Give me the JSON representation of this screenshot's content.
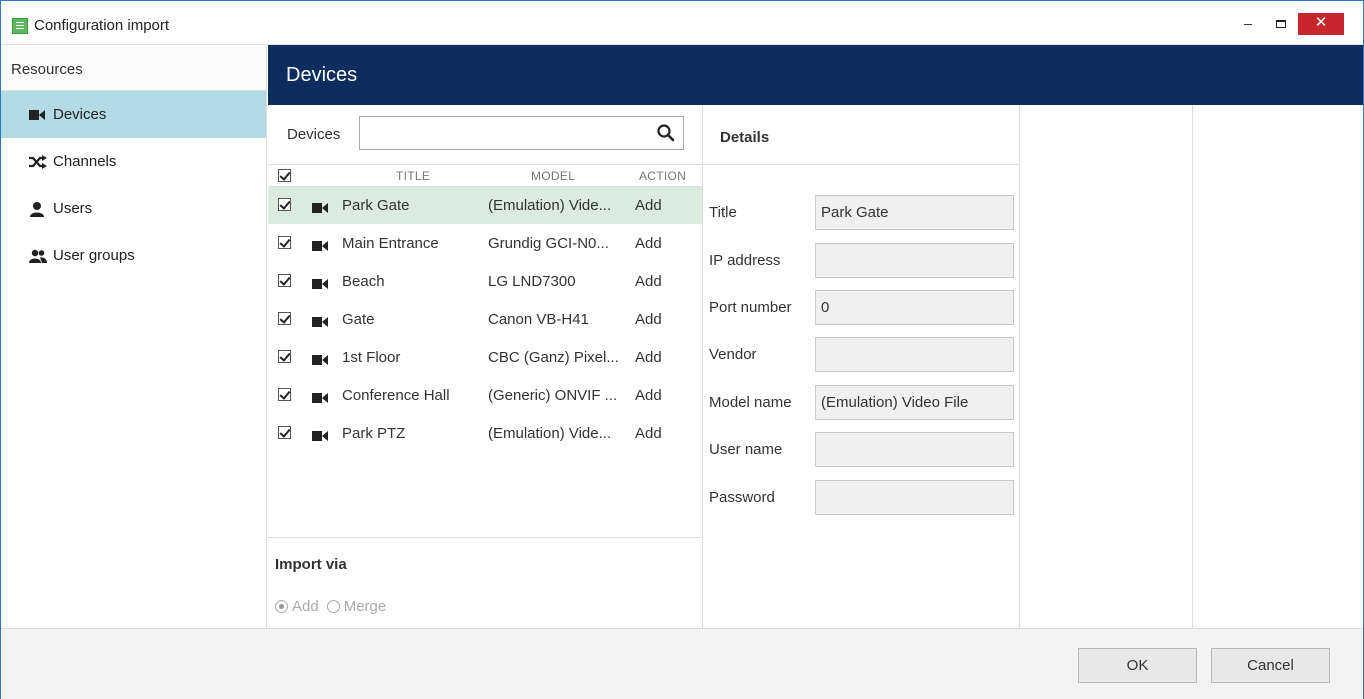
{
  "window": {
    "title": "Configuration import",
    "minimize": "–",
    "close": "✕"
  },
  "sidebar": {
    "header": "Resources",
    "items": [
      {
        "label": "Devices",
        "icon": "camera-icon",
        "active": true
      },
      {
        "label": "Channels",
        "icon": "shuffle-icon",
        "active": false
      },
      {
        "label": "Users",
        "icon": "user-icon",
        "active": false
      },
      {
        "label": "User groups",
        "icon": "users-icon",
        "active": false
      }
    ]
  },
  "main": {
    "header": "Devices"
  },
  "devices_panel": {
    "search_label": "Devices",
    "search_value": "",
    "columns": {
      "title": "TITLE",
      "model": "MODEL",
      "action": "ACTION"
    },
    "rows": [
      {
        "title": "Park Gate",
        "model": "(Emulation) Vide...",
        "action": "Add",
        "checked": true,
        "selected": true
      },
      {
        "title": "Main Entrance",
        "model": "Grundig GCI-N0...",
        "action": "Add",
        "checked": true,
        "selected": false
      },
      {
        "title": "Beach",
        "model": "LG LND7300",
        "action": "Add",
        "checked": true,
        "selected": false
      },
      {
        "title": "Gate",
        "model": "Canon VB-H41",
        "action": "Add",
        "checked": true,
        "selected": false
      },
      {
        "title": "1st Floor",
        "model": "CBC (Ganz) Pixel...",
        "action": "Add",
        "checked": true,
        "selected": false
      },
      {
        "title": "Conference Hall",
        "model": "(Generic) ONVIF ...",
        "action": "Add",
        "checked": true,
        "selected": false
      },
      {
        "title": "Park PTZ",
        "model": "(Emulation) Vide...",
        "action": "Add",
        "checked": true,
        "selected": false
      }
    ],
    "import_via": {
      "title": "Import via",
      "options": [
        "Add",
        "Merge"
      ],
      "selected": "Add"
    }
  },
  "details": {
    "title": "Details",
    "fields": [
      {
        "label": "Title",
        "value": "Park Gate"
      },
      {
        "label": "IP address",
        "value": ""
      },
      {
        "label": "Port number",
        "value": "0"
      },
      {
        "label": "Vendor",
        "value": ""
      },
      {
        "label": "Model name",
        "value": "(Emulation) Video File"
      },
      {
        "label": "User name",
        "value": ""
      },
      {
        "label": "Password",
        "value": ""
      }
    ]
  },
  "footer": {
    "ok": "OK",
    "cancel": "Cancel"
  },
  "colors": {
    "header_bg": "#0c2d5e",
    "sidebar_active": "#b3dbe5",
    "row_selected": "#d9ecde",
    "close_button": "#c7272c",
    "window_border": "#2b78c5"
  }
}
